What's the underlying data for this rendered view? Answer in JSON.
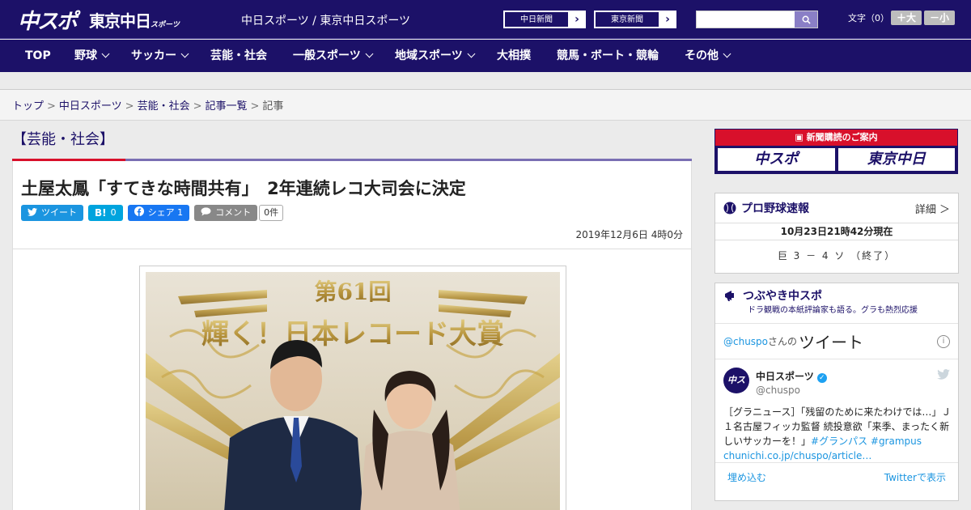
{
  "header": {
    "logo_chuspo": "中スポ",
    "logo_tokyo": "東京中日",
    "logo_tokyo_sub": "スポーツ",
    "site_title": "中日スポーツ / 東京中日スポーツ",
    "paper_buttons": [
      "中日新聞",
      "東京新聞"
    ],
    "search_placeholder": "",
    "font_label": "文字（0）",
    "font_bigger": "＋大",
    "font_smaller": "－小"
  },
  "nav": {
    "items": [
      {
        "label": "TOP",
        "dropdown": false
      },
      {
        "label": "野球",
        "dropdown": true
      },
      {
        "label": "サッカー",
        "dropdown": true
      },
      {
        "label": "芸能・社会",
        "dropdown": false
      },
      {
        "label": "一般スポーツ",
        "dropdown": true
      },
      {
        "label": "地域スポーツ",
        "dropdown": true
      },
      {
        "label": "大相撲",
        "dropdown": false
      },
      {
        "label": "競馬・ボート・競輪",
        "dropdown": false
      },
      {
        "label": "その他",
        "dropdown": true
      }
    ]
  },
  "breadcrumb": {
    "items": [
      "トップ",
      "中日スポーツ",
      "芸能・社会",
      "記事一覧"
    ],
    "current": "記事"
  },
  "article": {
    "category": "【芸能・社会】",
    "title": "土屋太鳳「すてきな時間共有」　2年連続レコ大司会に決定",
    "share": {
      "tweet": "ツイート",
      "hatena_icon": "B!",
      "hatena_count": "0",
      "facebook": "シェア",
      "facebook_count": "1",
      "comment": "コメント",
      "comment_count": "0件"
    },
    "date": "2019年12月6日 4時0分",
    "photo_banner": "第61回",
    "photo_banner_title": "輝く！日本レコード大賞"
  },
  "sidebar": {
    "subscribe_label": "新聞購読のご案内",
    "subscribe_logos": [
      "中スポ",
      "東京中日"
    ],
    "baseball": {
      "title": "プロ野球速報",
      "more": "詳細 ＞",
      "as_of": "10月23日21時42分現在",
      "score": "巨 3 － 4 ソ （終了）"
    },
    "tweets": {
      "title": "つぶやき中スポ",
      "subtitle": "ドラ観戦の本紙評論家も語る。グラも熱烈応援",
      "handle": "@chuspo",
      "handle_suffix": "さんの",
      "word": "ツイート",
      "account_name": "中日スポーツ",
      "account_user": "@chuspo",
      "text_main": "［グラニュース］「残留のために来たわけでは…」Ｊ１名古屋フィッカ監督 続投意欲「来季、まったく新しいサッカーを！」",
      "text_tags": "#グランパス #grampus",
      "text_link": "chunichi.co.jp/chuspo/article…",
      "embed": "埋め込む",
      "view_on": "Twitterで表示"
    }
  },
  "colors": {
    "brand_navy": "#1c1168",
    "accent_red": "#d8102b",
    "twitter_blue": "#1b95e0",
    "facebook_blue": "#1877f2",
    "hatena_blue": "#00a4de"
  }
}
